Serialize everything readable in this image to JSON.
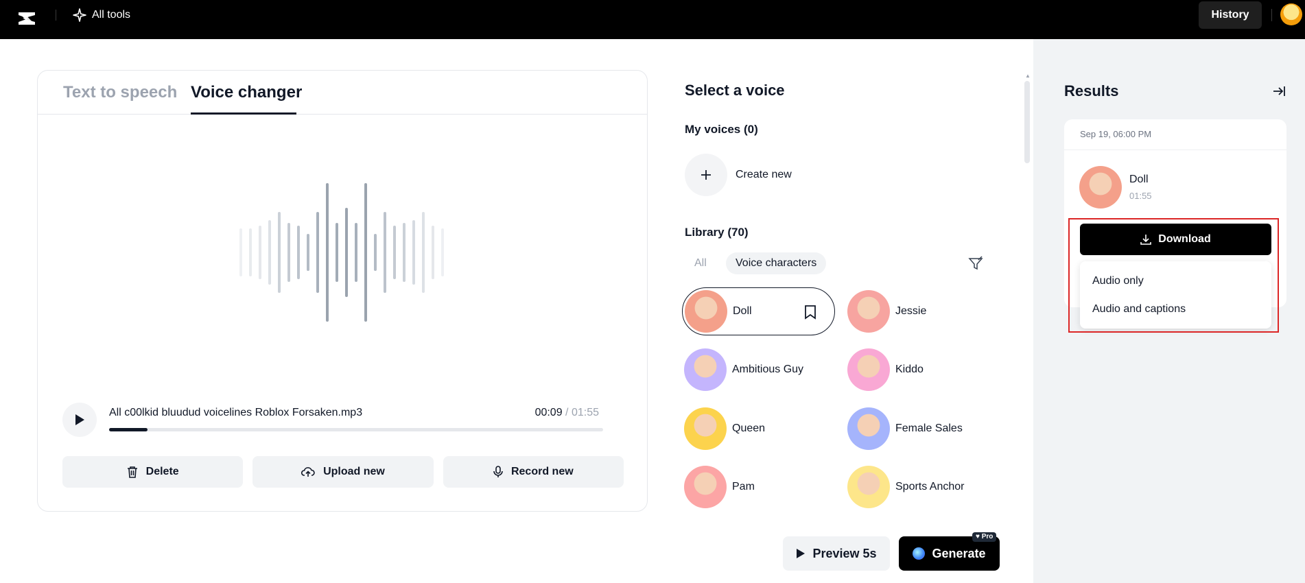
{
  "topbar": {
    "all_tools_label": "All tools",
    "history_label": "History"
  },
  "tabs": [
    {
      "label": "Text to speech",
      "active": false
    },
    {
      "label": "Voice changer",
      "active": true
    }
  ],
  "player": {
    "file_name": "All c00lkid bluudud voicelines Roblox Forsaken.mp3",
    "current_time": "00:09",
    "separator": " / ",
    "total_time": "01:55",
    "progress": 0.078
  },
  "actions": {
    "delete_label": "Delete",
    "upload_label": "Upload new",
    "record_label": "Record new"
  },
  "voices_panel": {
    "title": "Select a voice",
    "my_voices_label": "My voices (0)",
    "create_new_label": "Create new",
    "library_label": "Library (70)",
    "filter_all": "All",
    "filter_voice_characters": "Voice characters",
    "voices": [
      {
        "name": "Doll",
        "selected": true,
        "color": "#f4a08a"
      },
      {
        "name": "Jessie",
        "selected": false,
        "color": "#f7a4a0"
      },
      {
        "name": "Ambitious Guy",
        "selected": false,
        "color": "#c4b5fd"
      },
      {
        "name": "Kiddo",
        "selected": false,
        "color": "#f9a8d4"
      },
      {
        "name": "Queen",
        "selected": false,
        "color": "#fcd34d"
      },
      {
        "name": "Female Sales",
        "selected": false,
        "color": "#a5b4fc"
      },
      {
        "name": "Pam",
        "selected": false,
        "color": "#fca5a5"
      },
      {
        "name": "Sports Anchor",
        "selected": false,
        "color": "#fde68a"
      }
    ]
  },
  "footer": {
    "preview_label": "Preview 5s",
    "generate_label": "Generate",
    "pro_label": "Pro"
  },
  "results": {
    "title": "Results",
    "date": "Sep 19, 06:00 PM",
    "item_name": "Doll",
    "item_duration": "01:55",
    "download_label": "Download",
    "menu": [
      "Audio only",
      "Audio and captions"
    ]
  },
  "colors": {
    "accent": "#000000",
    "highlight_border": "#dc2626",
    "panel_bg": "#f1f3f5"
  }
}
